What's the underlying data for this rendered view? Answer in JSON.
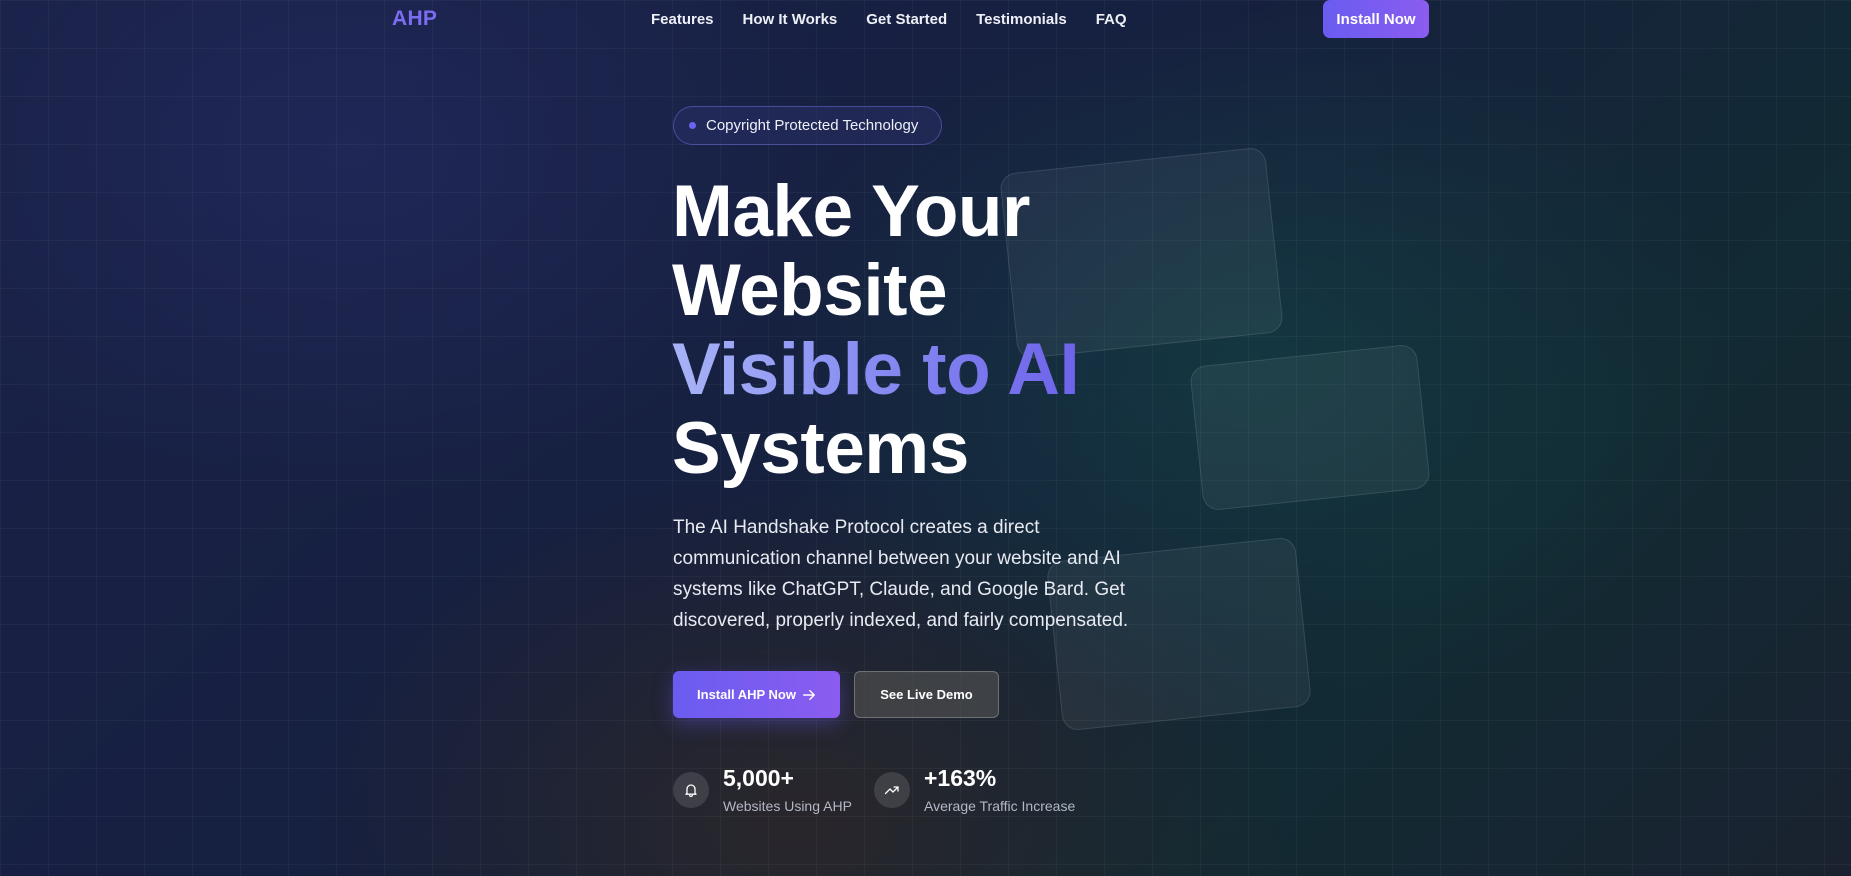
{
  "nav": {
    "logo": "AHP",
    "links": [
      "Features",
      "How It Works",
      "Get Started",
      "Testimonials",
      "FAQ"
    ],
    "cta": "Install Now"
  },
  "hero": {
    "badge": "Copyright Protected Technology",
    "headline": {
      "line1": "Make Your",
      "line2": "Website",
      "line3_accent": "Visible to AI",
      "line4": "Systems"
    },
    "description": "The AI Handshake Protocol creates a direct communication channel between your website and AI systems like ChatGPT, Claude, and Google Bard. Get discovered, properly indexed, and fairly compensated.",
    "primary_button": "Install AHP Now",
    "secondary_button": "See Live Demo",
    "stats": [
      {
        "icon": "bell-icon",
        "value": "5,000+",
        "label": "Websites Using AHP"
      },
      {
        "icon": "trending-up-icon",
        "value": "+163%",
        "label": "Average Traffic Increase"
      }
    ]
  },
  "colors": {
    "accent": "#6a5cf0",
    "accent_secondary": "#8b5cf0",
    "logo": "#7b6cf0"
  }
}
